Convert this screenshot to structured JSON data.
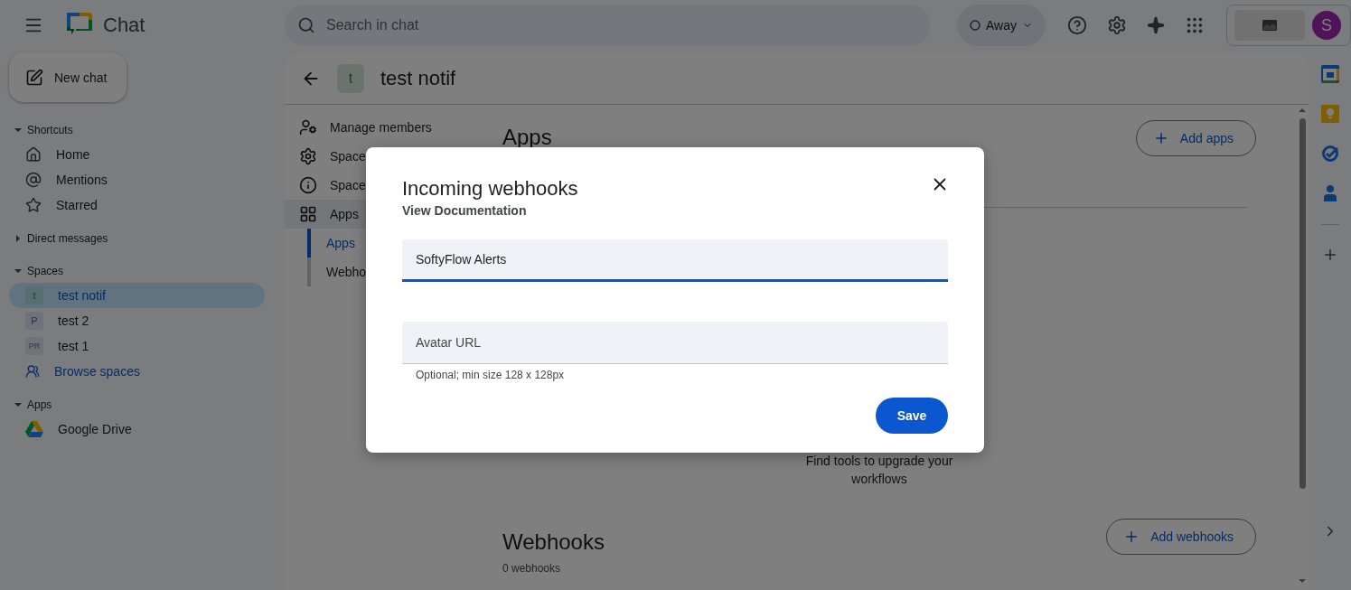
{
  "topbar": {
    "app_name": "Chat",
    "search": {
      "placeholder": "Search in chat"
    },
    "status": "Away",
    "avatar": "S"
  },
  "sidebar": {
    "new_chat": "New chat",
    "sections": [
      {
        "title": "Shortcuts",
        "expanded": true,
        "items": [
          {
            "kind": "shortcut",
            "label": "Home",
            "selected": false
          },
          {
            "kind": "shortcut",
            "label": "Mentions",
            "selected": false
          },
          {
            "kind": "shortcut",
            "label": "Starred",
            "selected": false
          }
        ]
      },
      {
        "title": "Direct messages",
        "expanded": false
      },
      {
        "title": "Spaces",
        "expanded": true,
        "items": [
          {
            "kind": "space",
            "label": "test notif",
            "avatar": "t",
            "selected": true
          },
          {
            "kind": "space",
            "label": "test 2",
            "avatar": "P",
            "selected": false
          },
          {
            "kind": "space",
            "label": "test 1",
            "avatar": "PR",
            "selected": false
          },
          {
            "kind": "browse",
            "label": "Browse spaces",
            "selected": false
          }
        ]
      },
      {
        "title": "Apps",
        "expanded": true,
        "items": [
          {
            "kind": "app",
            "label": "Google Drive",
            "selected": false
          }
        ]
      }
    ]
  },
  "space": {
    "title": "test notif",
    "avatar": "t",
    "nav": [
      {
        "label": "Manage members",
        "selected": false
      },
      {
        "label": "Space",
        "selected": false
      },
      {
        "label": "Space",
        "selected": false
      },
      {
        "label": "Apps",
        "selected": true,
        "children": [
          {
            "label": "Apps",
            "selected": true
          },
          {
            "label": "Webho",
            "selected": false
          }
        ]
      }
    ],
    "apps_section": {
      "title": "Apps",
      "button": "Add apps",
      "empty_text": "Find tools to upgrade your workflows"
    },
    "webhooks_section": {
      "title": "Webhooks",
      "count": "0 webhooks",
      "button": "Add webhooks"
    }
  },
  "dialog": {
    "title": "Incoming webhooks",
    "link": "View Documentation",
    "fields": [
      {
        "value": "SoftyFlow Alerts",
        "focused": true
      },
      {
        "placeholder": "Avatar URL",
        "helper": "Optional; min size 128 x 128px",
        "focused": false
      }
    ],
    "button": "Save"
  }
}
